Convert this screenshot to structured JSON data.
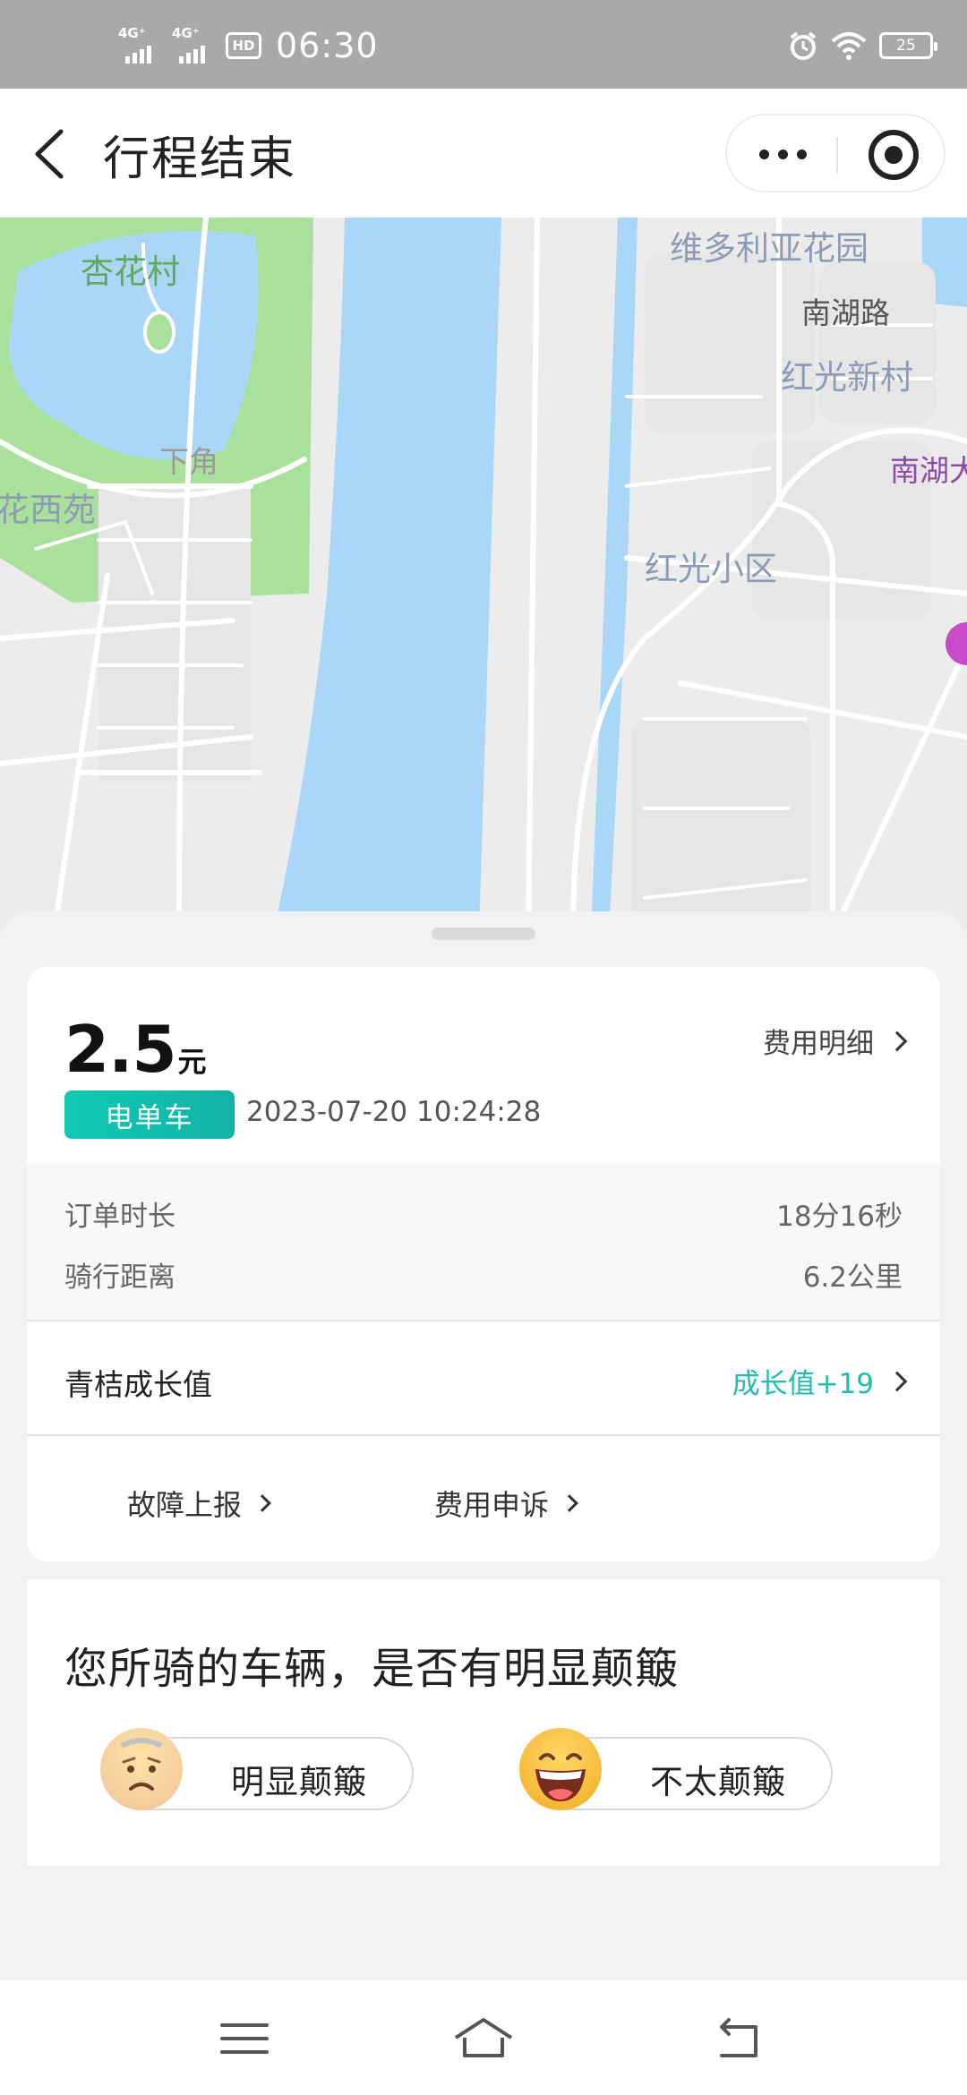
{
  "status_bar": {
    "signal_1": "4G⁺",
    "signal_2": "4G⁺",
    "hd": "HD",
    "time": "06:30",
    "battery": "25",
    "icons": [
      "alarm-icon",
      "wifi-icon",
      "battery-icon"
    ]
  },
  "header": {
    "title": "行程结束",
    "icons": [
      "back-arrow-icon",
      "more-icon",
      "target-icon"
    ]
  },
  "map": {
    "labels": [
      "杏花村",
      "维多利亚花园",
      "南湖路",
      "红光新村",
      "下角",
      "花西苑",
      "南湖大",
      "红光小区"
    ],
    "colors": {
      "water": "#aad7f7",
      "park": "#a7e09a",
      "land": "#ececec",
      "road": "#ffffff"
    }
  },
  "trip": {
    "amount": "2.5",
    "unit": "元",
    "fee_detail_label": "费用明细",
    "vehicle_badge": "电单车",
    "datetime": "2023-07-20 10:24:28",
    "stats": [
      {
        "label": "订单时长",
        "value": "18分16秒"
      },
      {
        "label": "骑行距离",
        "value": "6.2公里"
      }
    ],
    "growth_label": "青桔成长值",
    "growth_value": "成长值+19",
    "actions": [
      "故障上报",
      "费用申诉"
    ],
    "accent_color": "#22bcae"
  },
  "survey": {
    "question": "您所骑的车辆，是否有明显颠簸",
    "options": [
      {
        "label": "明显颠簸",
        "icon": "sad-face-icon"
      },
      {
        "label": "不太颠簸",
        "icon": "happy-face-icon"
      }
    ]
  },
  "nav": {
    "icons": [
      "menu-icon",
      "home-icon",
      "back-icon"
    ]
  }
}
